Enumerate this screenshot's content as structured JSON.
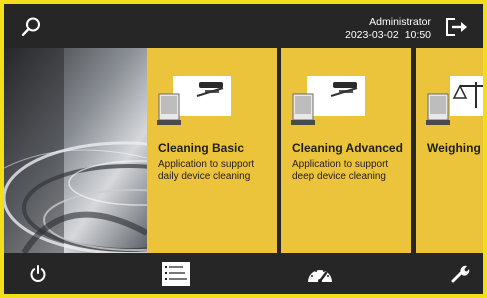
{
  "header": {
    "user": "Administrator",
    "date": "2023-03-02",
    "time": "10:50"
  },
  "tiles": [
    {
      "title": "Cleaning Basic",
      "description": "Application to support daily device cleaning",
      "icon": "cleaning-device-icon"
    },
    {
      "title": "Cleaning Advanced",
      "description": "Application to support deep device cleaning",
      "icon": "cleaning-device-icon"
    },
    {
      "title": "Weighing",
      "description": "",
      "icon": "weighing-scale-icon"
    }
  ],
  "bottom_bar": {
    "icons": [
      "power-icon",
      "task-list-icon",
      "speedometer-icon",
      "wrench-icon"
    ]
  },
  "colors": {
    "bezel": "#f1df1b",
    "tile": "#ecc43b",
    "bar": "#262626"
  }
}
